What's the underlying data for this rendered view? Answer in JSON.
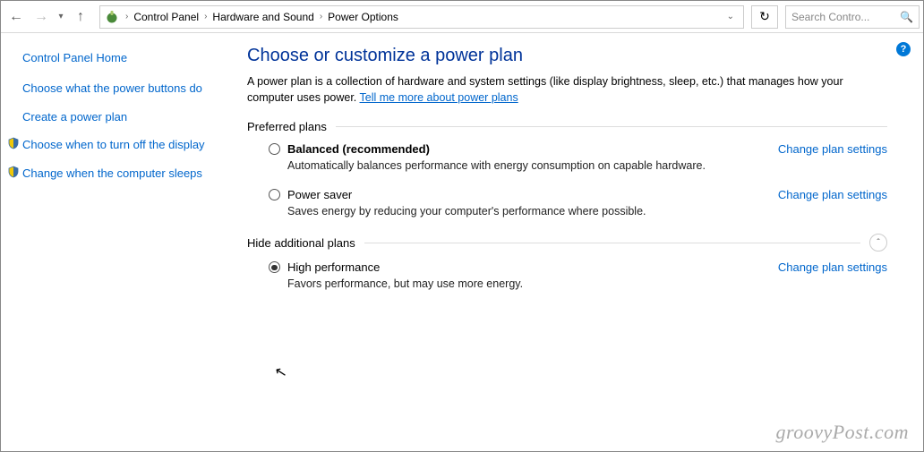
{
  "breadcrumbs": {
    "item0": "Control Panel",
    "item1": "Hardware and Sound",
    "item2": "Power Options"
  },
  "search": {
    "placeholder": "Search Contro..."
  },
  "sidebar": {
    "home": "Control Panel Home",
    "link0": "Choose what the power buttons do",
    "link1": "Create a power plan",
    "link2": "Choose when to turn off the display",
    "link3": "Change when the computer sleeps"
  },
  "main": {
    "heading": "Choose or customize a power plan",
    "desc_pre": "A power plan is a collection of hardware and system settings (like display brightness, sleep, etc.) that manages how your computer uses power. ",
    "desc_link": "Tell me more about power plans",
    "section_preferred": "Preferred plans",
    "section_additional": "Hide additional plans",
    "change_link": "Change plan settings",
    "plans": {
      "balanced": {
        "name": "Balanced (recommended)",
        "desc": "Automatically balances performance with energy consumption on capable hardware."
      },
      "saver": {
        "name": "Power saver",
        "desc": "Saves energy by reducing your computer's performance where possible."
      },
      "high": {
        "name": "High performance",
        "desc": "Favors performance, but may use more energy."
      }
    }
  },
  "watermark": "groovyPost.com"
}
